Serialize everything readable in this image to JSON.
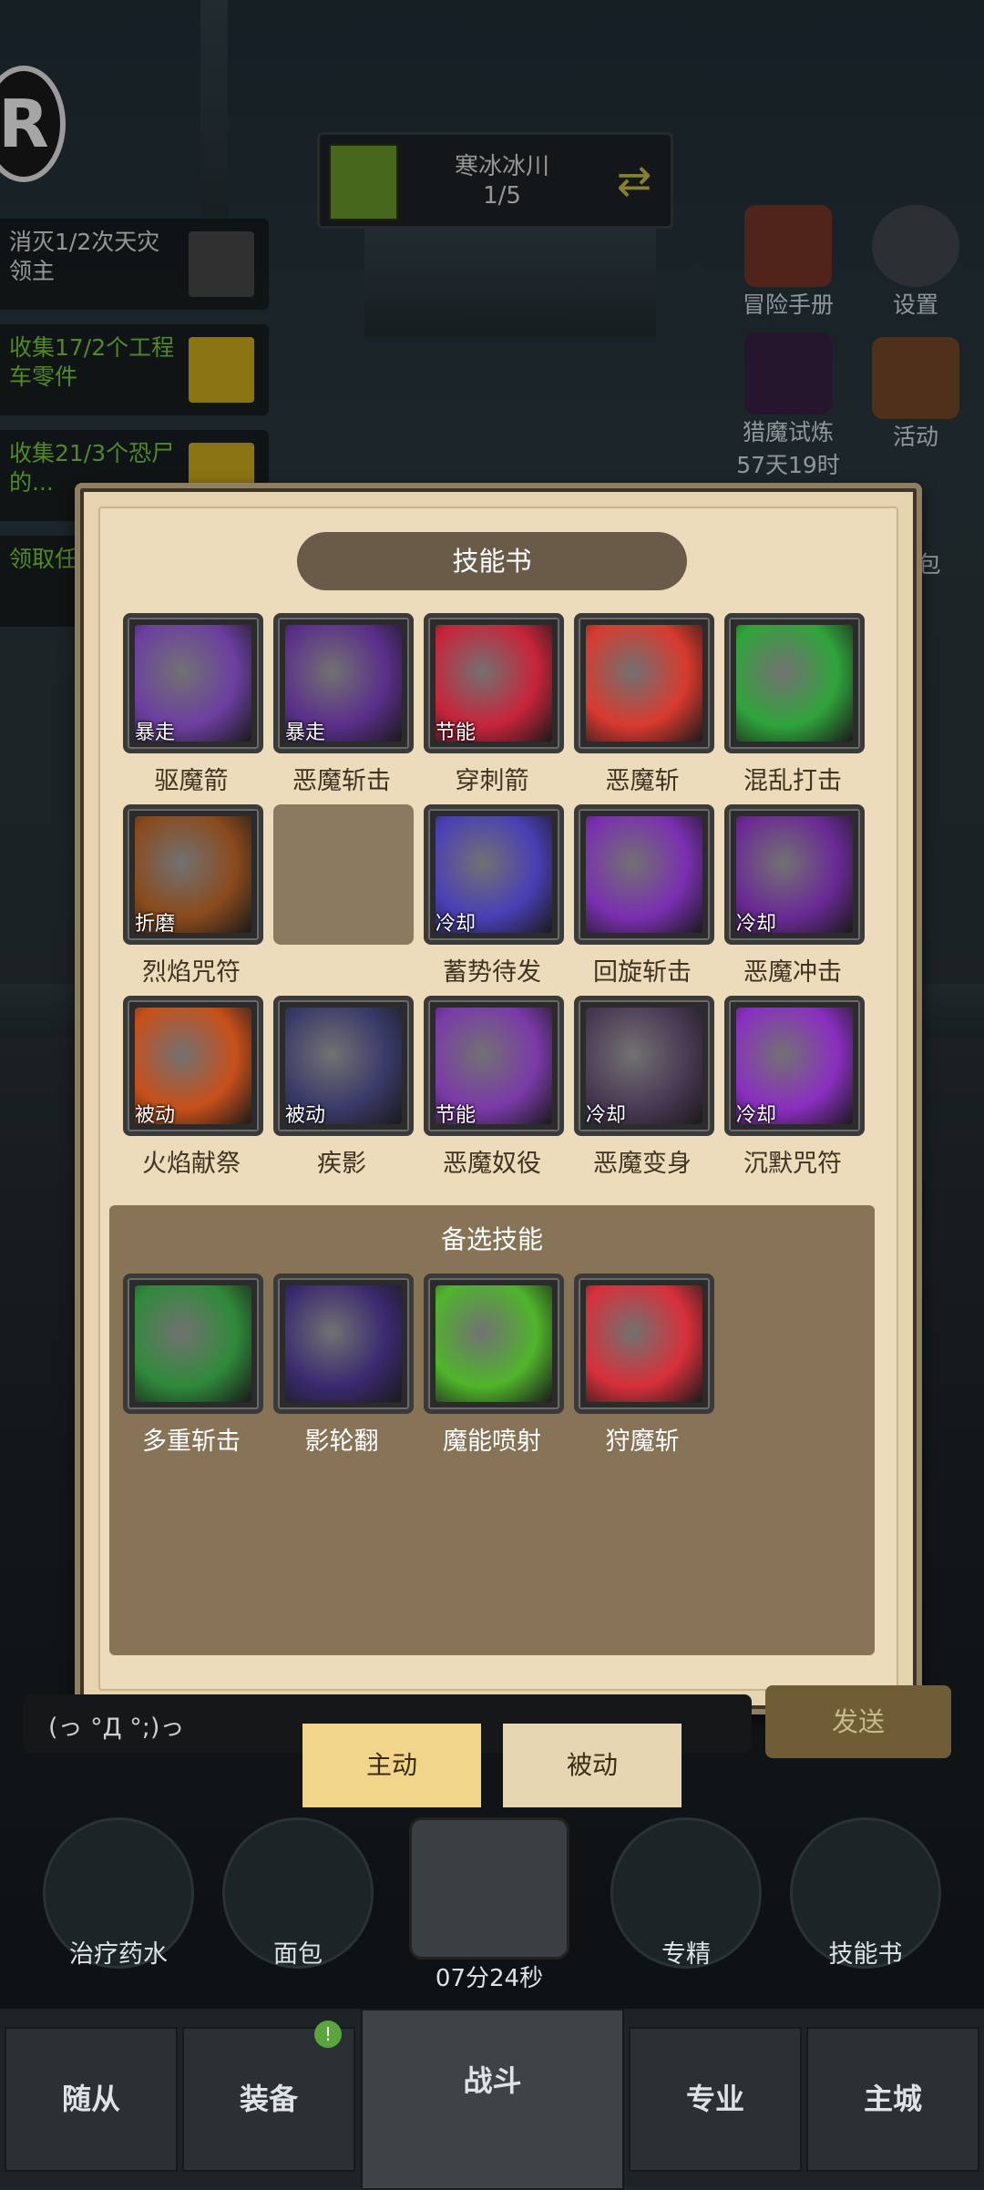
{
  "stage": {
    "title": "寒冰冰川",
    "progress": "1/5"
  },
  "quests": [
    {
      "text": "消灭1/2次天灾领主"
    },
    {
      "text": "收集17/2个工程车零件"
    },
    {
      "text": "收集21/3个恐尸的..."
    },
    {
      "text": "领取任..."
    }
  ],
  "right_buttons": {
    "adventure_handbook": "冒险手册",
    "settings": "设置",
    "demon_trial": "猎魔试炼",
    "demon_trial_timer": "57天19时",
    "events": "活动",
    "bag": "包"
  },
  "dialog": {
    "title": "技能书",
    "skills": [
      {
        "name": "驱魔箭",
        "tag": "暴走",
        "color": "#6b3fa0"
      },
      {
        "name": "恶魔斩击",
        "tag": "暴走",
        "color": "#5a2f8a"
      },
      {
        "name": "穿刺箭",
        "tag": "节能",
        "color": "#c8243a"
      },
      {
        "name": "恶魔斩",
        "tag": "",
        "color": "#d83a2e"
      },
      {
        "name": "混乱打击",
        "tag": "",
        "color": "#2fa43b"
      },
      {
        "name": "烈焰咒符",
        "tag": "折磨",
        "color": "#8a4a1c"
      },
      {
        "name": "",
        "tag": "",
        "color": ""
      },
      {
        "name": "蓄势待发",
        "tag": "冷却",
        "color": "#4a3fb5"
      },
      {
        "name": "回旋斩击",
        "tag": "",
        "color": "#7a2fb0"
      },
      {
        "name": "恶魔冲击",
        "tag": "冷却",
        "color": "#6a2a95"
      },
      {
        "name": "火焰献祭",
        "tag": "被动",
        "color": "#c8501a"
      },
      {
        "name": "疾影",
        "tag": "被动",
        "color": "#3a3a6a"
      },
      {
        "name": "恶魔奴役",
        "tag": "节能",
        "color": "#7a3aa8"
      },
      {
        "name": "恶魔变身",
        "tag": "冷却",
        "color": "#4a3a55"
      },
      {
        "name": "沉默咒符",
        "tag": "冷却",
        "color": "#8a2fc0"
      }
    ],
    "alt_title": "备选技能",
    "alt_skills": [
      {
        "name": "多重斩击",
        "color": "#2f8a3a"
      },
      {
        "name": "影轮翻",
        "color": "#3a2a70"
      },
      {
        "name": "魔能喷射",
        "color": "#4fb52a"
      },
      {
        "name": "狩魔斩",
        "color": "#d8303a"
      }
    ]
  },
  "chat": {
    "emote": "(っ °Д °;)っ",
    "send_label": "发送"
  },
  "mode_tabs": {
    "active": "主动",
    "passive": "被动"
  },
  "quick_items": {
    "potion": "治疗药水",
    "bread": "面包",
    "chest_timer": "07分24秒",
    "specialize": "专精",
    "skillbook": "技能书"
  },
  "nav": {
    "followers": "随从",
    "equipment": "装备",
    "equipment_badge": "!",
    "battle": "战斗",
    "profession": "专业",
    "city": "主城"
  }
}
